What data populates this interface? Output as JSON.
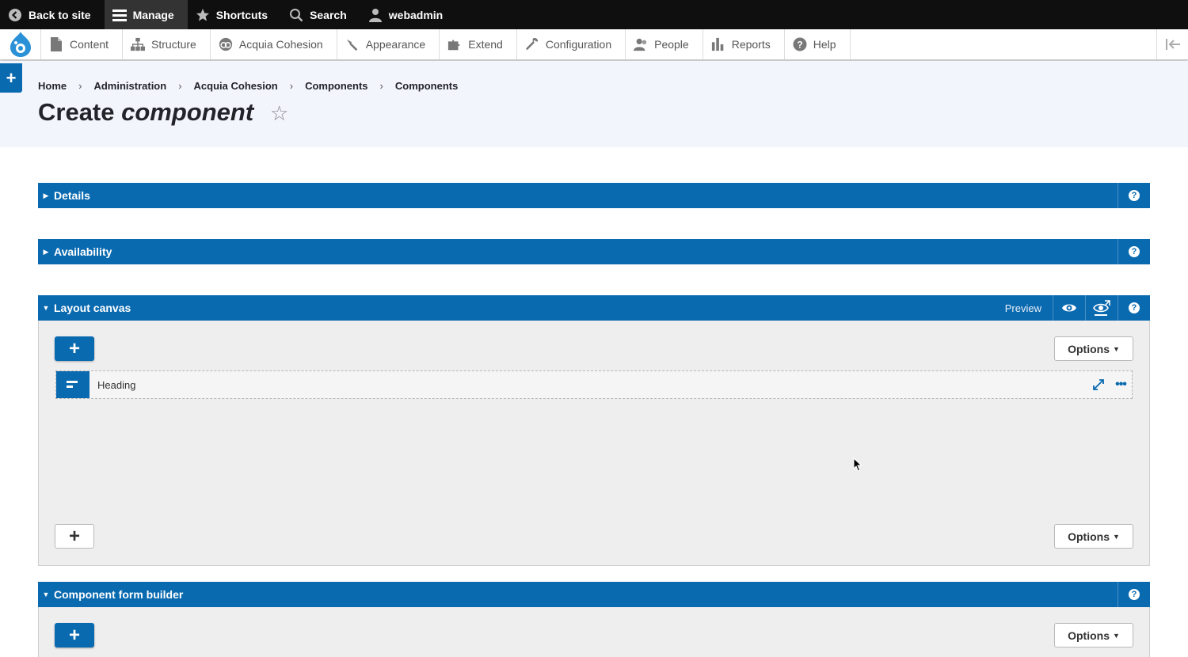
{
  "toolbar": {
    "back_to_site": "Back to site",
    "manage": "Manage",
    "shortcuts": "Shortcuts",
    "search": "Search",
    "user": "webadmin"
  },
  "tray": {
    "items": [
      {
        "label": "Content",
        "icon": "file-icon"
      },
      {
        "label": "Structure",
        "icon": "sitemap-icon"
      },
      {
        "label": "Acquia Cohesion",
        "icon": "cohesion-icon"
      },
      {
        "label": "Appearance",
        "icon": "paintbrush-icon"
      },
      {
        "label": "Extend",
        "icon": "puzzle-icon"
      },
      {
        "label": "Configuration",
        "icon": "wrench-icon"
      },
      {
        "label": "People",
        "icon": "people-icon"
      },
      {
        "label": "Reports",
        "icon": "bar-chart-icon"
      },
      {
        "label": "Help",
        "icon": "help-icon"
      }
    ]
  },
  "breadcrumb": [
    "Home",
    "Administration",
    "Acquia Cohesion",
    "Components",
    "Components"
  ],
  "page": {
    "title_plain": "Create",
    "title_italic": "component"
  },
  "panels": {
    "details": "Details",
    "availability": "Availability",
    "layout_canvas": "Layout canvas",
    "preview": "Preview",
    "form_builder": "Component form builder"
  },
  "canvas": {
    "add": "+",
    "options": "Options",
    "element_label": "Heading"
  },
  "colors": {
    "accent": "#0a6ab0",
    "toolbar_bg": "#0f0f0f",
    "header_bg": "#f3f5fd"
  }
}
